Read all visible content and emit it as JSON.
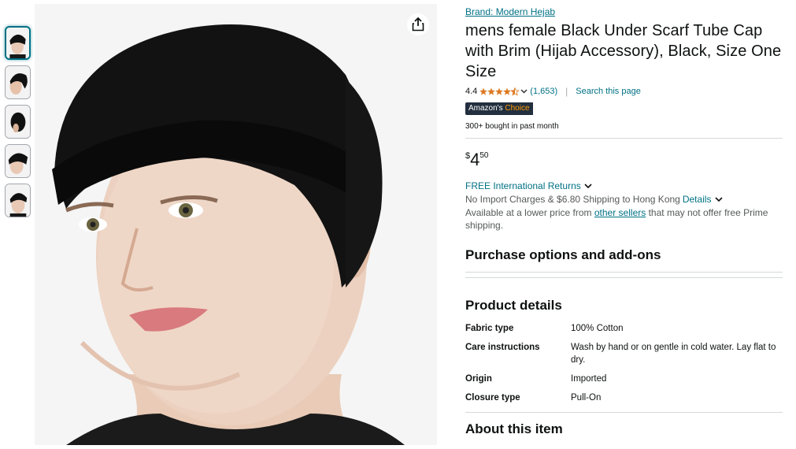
{
  "thumbnails": [
    {
      "label": "thumbnail-1",
      "active": true
    },
    {
      "label": "thumbnail-2",
      "active": false
    },
    {
      "label": "thumbnail-3",
      "active": false
    },
    {
      "label": "thumbnail-4",
      "active": false
    },
    {
      "label": "thumbnail-5",
      "active": false
    }
  ],
  "product": {
    "brand_link": "Brand: Modern Hejab",
    "title": "mens female Black Under Scarf Tube Cap with Brim (Hijab Accessory), Black, Size One Size",
    "rating_value": "4.4",
    "rating_stars": 4.4,
    "review_count": "(1,653)",
    "search_link": "Search this page",
    "badge_prefix": "Amazon's",
    "badge_suffix": "Choice",
    "bought": "300+ bought in past month",
    "price_symbol": "$",
    "price_whole": "4",
    "price_fraction": "50",
    "returns": "FREE International Returns",
    "shipping": "No Import Charges & $6.80 Shipping to Hong Kong",
    "shipping_details": "Details",
    "avail_prefix": "Available at a lower price from",
    "avail_link": "other sellers",
    "avail_suffix": "that may not offer free Prime shipping."
  },
  "sections": {
    "purchase_options": "Purchase options and add-ons",
    "product_details": "Product details",
    "about": "About this item"
  },
  "details": [
    {
      "key": "Fabric type",
      "value": "100% Cotton"
    },
    {
      "key": "Care instructions",
      "value": "Wash by hand or on gentle in cold water. Lay flat to dry."
    },
    {
      "key": "Origin",
      "value": "Imported"
    },
    {
      "key": "Closure type",
      "value": "Pull-On"
    }
  ],
  "colors": {
    "link": "#007185",
    "star": "#de7921",
    "badge_bg": "#232f3e",
    "badge_accent": "#ff9900"
  },
  "icons": {
    "share": "share-icon",
    "chevron": "chevron-down-icon",
    "star": "star-icon"
  }
}
